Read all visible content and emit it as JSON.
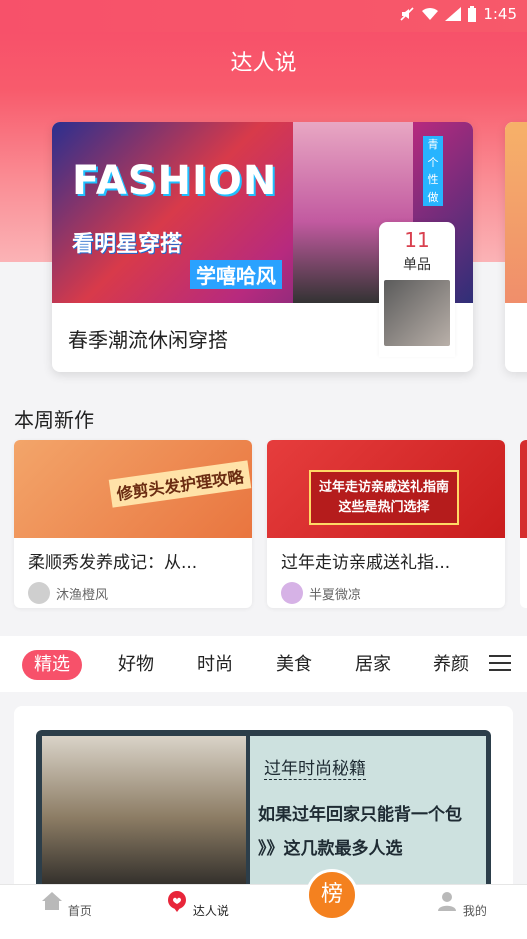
{
  "status_bar": {
    "time": "1:45"
  },
  "header": {
    "title": "达人说"
  },
  "hero": {
    "banner_fashion": "FASHION",
    "banner_line1": "看明星穿搭",
    "banner_line2": "学嘻哈风",
    "banner_side": "青个性做",
    "count": "11",
    "count_unit": "单品",
    "title": "春季潮流休闲穿搭"
  },
  "weekly": {
    "section_title": "本周新作",
    "cards": [
      {
        "img_text": "修剪头发护理攻略",
        "title": "柔顺秀发养成记：从...",
        "author": "沐渔橙风"
      },
      {
        "img_text": "过年走访亲戚送礼指南\n这些是热门选择",
        "title": "过年走访亲戚送礼指...",
        "author": "半夏微凉"
      }
    ]
  },
  "tabs": {
    "items": [
      "精选",
      "好物",
      "时尚",
      "美食",
      "居家",
      "养颜"
    ]
  },
  "feed": {
    "board_line1": "过年时尚秘籍",
    "board_line2": "如果过年回家只能背一个包",
    "board_line3": "》》这几款最多人选"
  },
  "bottom_nav": {
    "home": "首页",
    "talent": "达人说",
    "rank": "榜",
    "mine": "我的"
  },
  "colors": {
    "accent": "#f7516a",
    "rank": "#f4811f"
  }
}
